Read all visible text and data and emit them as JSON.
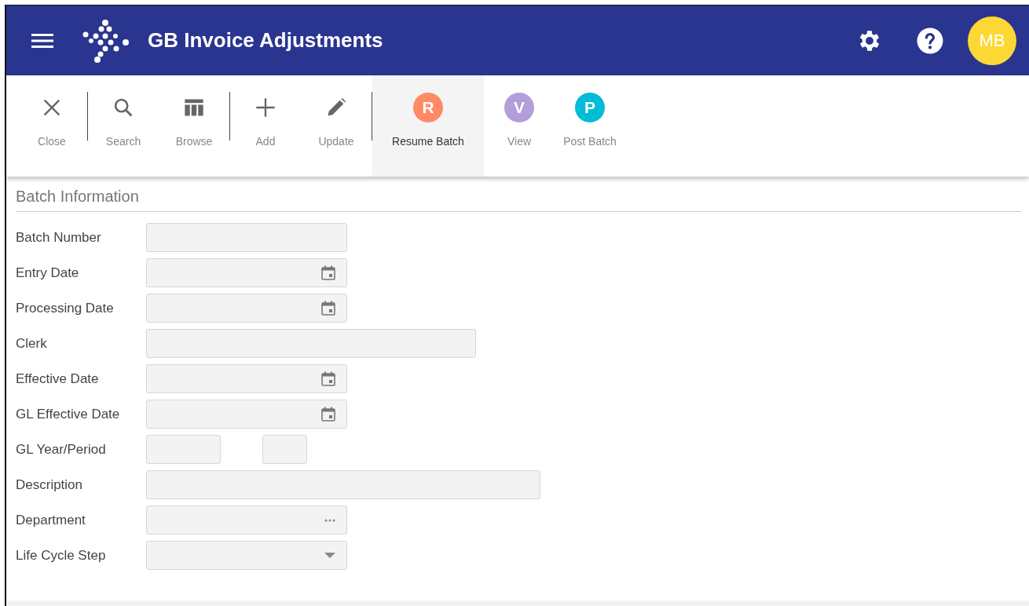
{
  "header": {
    "title": "GB Invoice Adjustments",
    "avatar": "MB"
  },
  "toolbar": {
    "groups": [
      [
        {
          "kind": "icon",
          "label": "Close",
          "selected": false
        }
      ],
      [
        {
          "kind": "icon",
          "label": "Search",
          "selected": false
        },
        {
          "kind": "icon",
          "label": "Browse",
          "selected": false
        }
      ],
      [
        {
          "kind": "icon",
          "label": "Add",
          "selected": false
        },
        {
          "kind": "icon",
          "label": "Update",
          "selected": false
        }
      ],
      [
        {
          "kind": "letter",
          "letter": "R",
          "color": "#ff8a65",
          "label": "Resume Batch",
          "selected": true
        },
        {
          "kind": "letter",
          "letter": "V",
          "color": "#b39ddb",
          "label": "View",
          "selected": false
        },
        {
          "kind": "letter",
          "letter": "P",
          "color": "#00bcd4",
          "label": "Post Batch",
          "selected": false
        }
      ]
    ]
  },
  "form": {
    "title": "Batch Information",
    "fields": [
      {
        "label": "Batch Number",
        "kind": "text"
      },
      {
        "label": "Entry Date",
        "kind": "date"
      },
      {
        "label": "Processing Date",
        "kind": "date"
      },
      {
        "label": "Clerk",
        "kind": "text"
      },
      {
        "label": "Effective Date",
        "kind": "date"
      },
      {
        "label": "GL Effective Date",
        "kind": "date"
      },
      {
        "label": "GL Year/Period",
        "kind": "pair"
      },
      {
        "label": "Description",
        "kind": "text"
      },
      {
        "label": "Department",
        "kind": "lookup"
      },
      {
        "label": "Life Cycle Step",
        "kind": "select"
      }
    ]
  }
}
